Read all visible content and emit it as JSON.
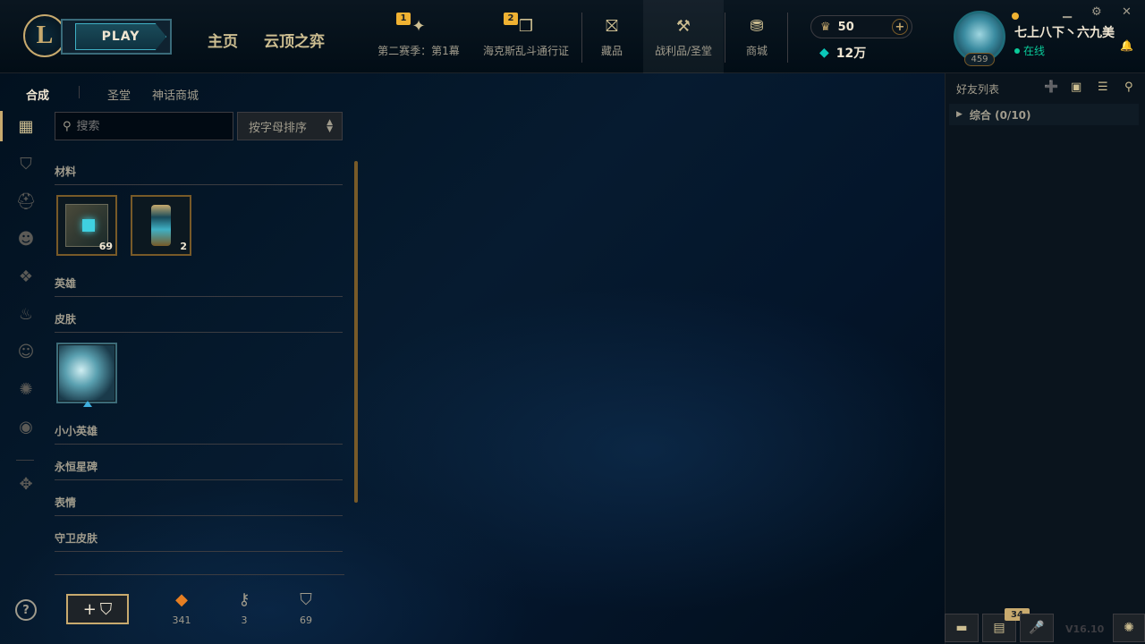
{
  "window": {
    "title": "League of Legends Client",
    "colors": {
      "accent": "#c8aa6e",
      "teal": "#0acb9a",
      "bg": "#010a13"
    }
  },
  "header": {
    "play_label": "PLAY",
    "nav_home": "主页",
    "nav_tft": "云顶之弈",
    "season_label": "第二赛季：第1幕",
    "season_badge": "1",
    "pass_label": "海克斯乱斗通行证",
    "pass_badge": "2",
    "collection_label": "藏品",
    "loot_label": "战利品/圣堂",
    "store_label": "商城",
    "rp_value": "50",
    "be_value": "12万",
    "summoner_name": "七上八下丶六九美",
    "summoner_status": "在线",
    "summoner_level": "459"
  },
  "loot": {
    "tabs": [
      "合成",
      "圣堂",
      "神话商城"
    ],
    "search_placeholder": "搜索",
    "sort_label": "按字母排序",
    "sections": {
      "materials": "材料",
      "champions": "英雄",
      "skins": "皮肤",
      "little_legends": "小小英雄",
      "eternals": "永恒星碑",
      "emotes": "表情",
      "ward_skins": "守卫皮肤"
    },
    "materials_items": [
      {
        "count": "69",
        "icon": "chest-icon"
      },
      {
        "count": "2",
        "icon": "lantern-icon"
      }
    ],
    "skin_items": [
      {
        "icon": "skin-shard-icon"
      }
    ],
    "resources": [
      {
        "icon": "orange-essence-icon",
        "value": "341"
      },
      {
        "icon": "key-fragment-icon",
        "value": "3"
      },
      {
        "icon": "chest-icon",
        "value": "69"
      }
    ]
  },
  "social": {
    "title": "好友列表",
    "group_label": "综合 (0/10)",
    "badge_count": "34",
    "version": "V16.10"
  }
}
